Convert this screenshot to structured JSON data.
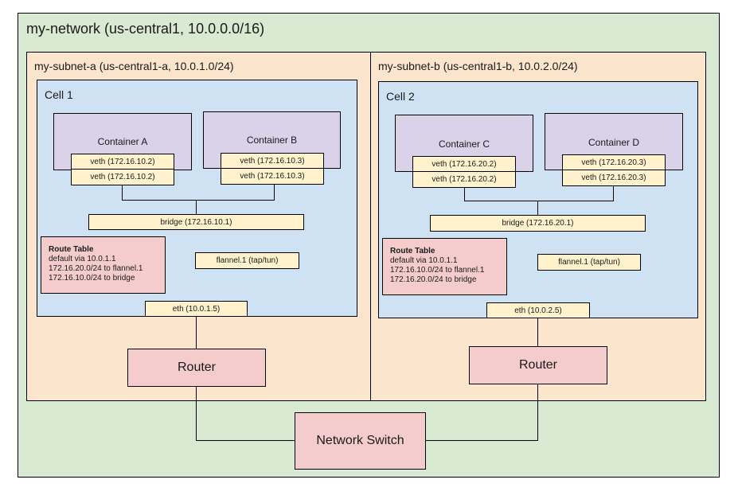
{
  "network": {
    "title": "my-network (us-central1, 10.0.0.0/16)",
    "subnets": [
      {
        "title": "my-subnet-a (us-central1-a, 10.0.1.0/24)",
        "cell": {
          "title": "Cell 1",
          "containers": [
            {
              "name": "Container A",
              "veth_inner": "veth (172.16.10.2)",
              "veth_outer": "veth (172.16.10.2)"
            },
            {
              "name": "Container B",
              "veth_inner": "veth (172.16.10.3)",
              "veth_outer": "veth (172.16.10.3)"
            }
          ],
          "bridge": "bridge (172.16.10.1)",
          "route_table": {
            "title": "Route Table",
            "entries": [
              "default via 10.0.1.1",
              "172.16.20.0/24 to flannel.1",
              "172.16.10.0/24 to bridge"
            ]
          },
          "flannel": "flannel.1 (tap/tun)",
          "eth": "eth (10.0.1.5)"
        },
        "router": "Router"
      },
      {
        "title": "my-subnet-b (us-central1-b, 10.0.2.0/24)",
        "cell": {
          "title": "Cell 2",
          "containers": [
            {
              "name": "Container C",
              "veth_inner": "veth (172.16.20.2)",
              "veth_outer": "veth (172.16.20.2)"
            },
            {
              "name": "Container D",
              "veth_inner": "veth (172.16.20.3)",
              "veth_outer": "veth (172.16.20.3)"
            }
          ],
          "bridge": "bridge (172.16.20.1)",
          "route_table": {
            "title": "Route Table",
            "entries": [
              "default via 10.0.1.1",
              "172.16.10.0/24 to flannel.1",
              "172.16.20.0/24 to bridge"
            ]
          },
          "flannel": "flannel.1 (tap/tun)",
          "eth": "eth (10.0.2.5)"
        },
        "router": "Router"
      }
    ],
    "switch": "Network Switch"
  },
  "colors": {
    "network": "#d9ead3",
    "subnet": "#fce5cd",
    "cell": "#cfe2f3",
    "container": "#d9d2e9",
    "interface": "#fff2cc",
    "router": "#f4cccc"
  }
}
